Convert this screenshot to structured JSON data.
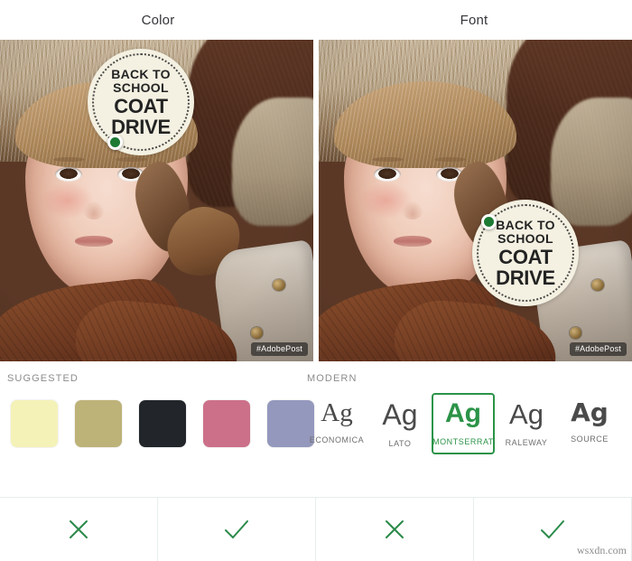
{
  "header": {
    "left_title": "Color",
    "right_title": "Font"
  },
  "panels": [
    {
      "id": "color-panel",
      "badge": {
        "line1": "BACK TO",
        "line2": "SCHOOL",
        "line3": "COAT",
        "line4": "DRIVE"
      },
      "watermark": "#AdobePost"
    },
    {
      "id": "font-panel",
      "badge": {
        "line1": "BACK TO",
        "line2": "SCHOOL",
        "line3": "COAT",
        "line4": "DRIVE"
      },
      "watermark": "#AdobePost"
    }
  ],
  "color_section": {
    "label": "SUGGESTED",
    "swatches": [
      {
        "name": "pale-yellow",
        "hex": "#f5f2b8"
      },
      {
        "name": "olive-khaki",
        "hex": "#bdb278"
      },
      {
        "name": "near-black",
        "hex": "#22262a"
      },
      {
        "name": "dusty-pink",
        "hex": "#cc7089"
      },
      {
        "name": "periwinkle",
        "hex": "#9498bd"
      }
    ]
  },
  "font_section": {
    "label": "MODERN",
    "glyph": "Ag",
    "selected_accent": "#2b9348",
    "fonts": [
      {
        "name": "ECONOMICA",
        "selected": false
      },
      {
        "name": "LATO",
        "selected": false
      },
      {
        "name": "MONTSERRAT",
        "selected": true
      },
      {
        "name": "RALEWAY",
        "selected": false
      },
      {
        "name": "SOURCE",
        "selected": false
      }
    ]
  },
  "actions": [
    {
      "name": "reject-color",
      "icon": "close-icon",
      "color": "#2b8a4a"
    },
    {
      "name": "accept-color",
      "icon": "check-icon",
      "color": "#2b8a4a"
    },
    {
      "name": "reject-font",
      "icon": "close-icon",
      "color": "#2b8a4a"
    },
    {
      "name": "accept-font",
      "icon": "check-icon",
      "color": "#2b8a4a"
    }
  ],
  "page_watermark": "wsxdn.com"
}
